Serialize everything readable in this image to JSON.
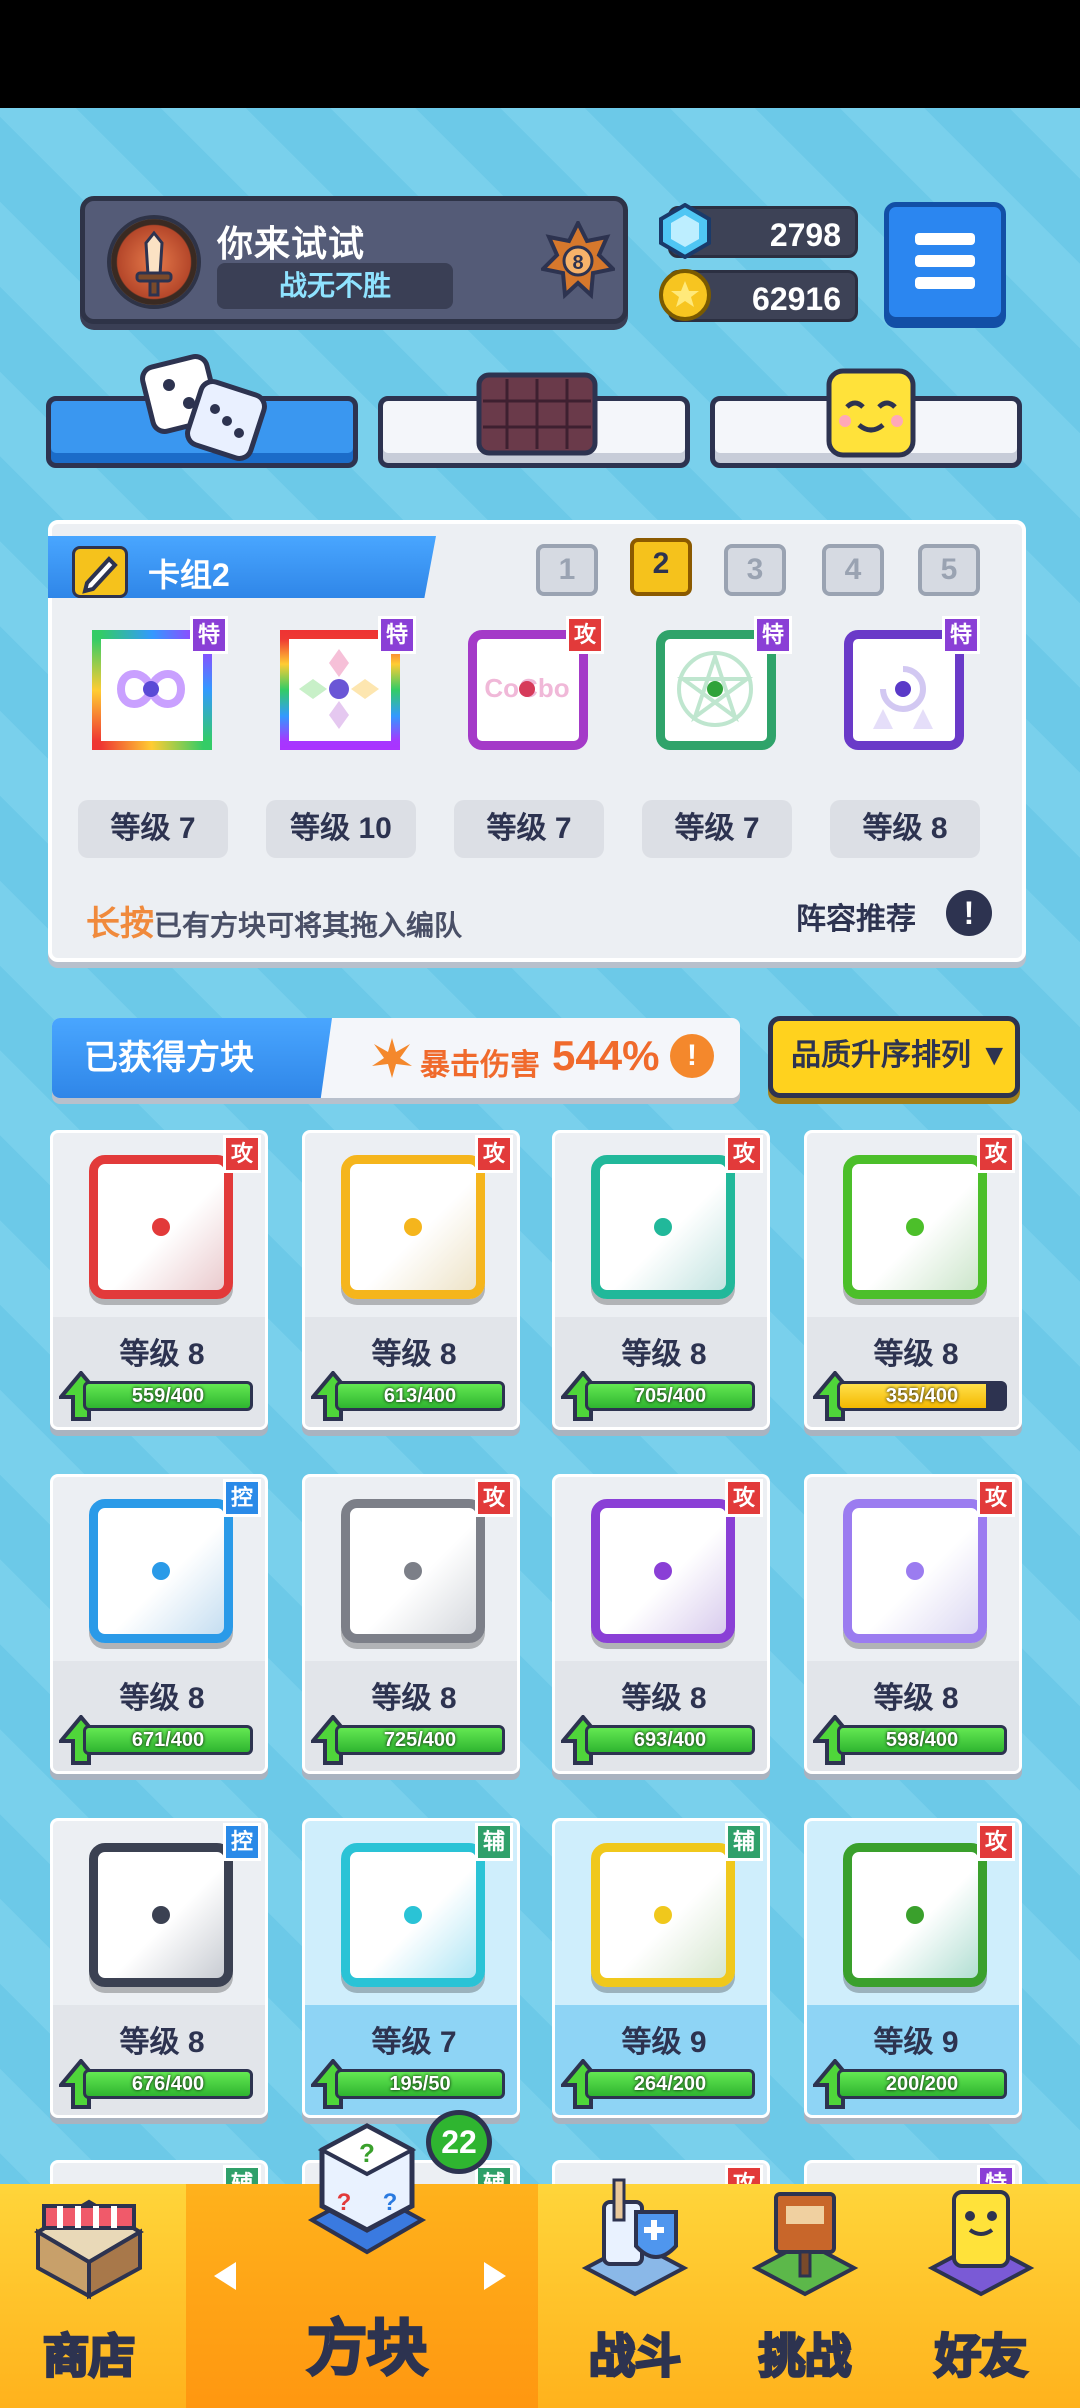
{
  "player": {
    "name": "你来试试",
    "title": "战无不胜",
    "rank": "8"
  },
  "currency": {
    "gems": "2798",
    "gold": "62916"
  },
  "deck": {
    "name": "卡组2",
    "tabs": [
      "1",
      "2",
      "3",
      "4",
      "5"
    ],
    "active_tab": "2",
    "cards": [
      {
        "tag": "特",
        "level": "等级 7",
        "tag_color": "#8a3fd6"
      },
      {
        "tag": "特",
        "level": "等级 10",
        "tag_color": "#8a3fd6"
      },
      {
        "tag": "攻",
        "level": "等级 7",
        "tag_color": "#e23a3a"
      },
      {
        "tag": "特",
        "level": "等级 7",
        "tag_color": "#8a3fd6"
      },
      {
        "tag": "特",
        "level": "等级 8",
        "tag_color": "#8a3fd6"
      }
    ],
    "hint_em": "长按",
    "hint_rest": "已有方块可将其拖入编队",
    "recommend": "阵容推荐",
    "info_icon": "!"
  },
  "owned": {
    "title": "已获得方块",
    "crit_label": "暴击伤害",
    "crit_value": "544%",
    "info_icon": "!",
    "sort_label": "品质升序排列 ▼"
  },
  "cards": [
    {
      "tag": "攻",
      "level": "等级 8",
      "progress": "559/400",
      "fill": 1.0,
      "color": "#e23a3a"
    },
    {
      "tag": "攻",
      "level": "等级 8",
      "progress": "613/400",
      "fill": 1.0,
      "color": "#f5b51c"
    },
    {
      "tag": "攻",
      "level": "等级 8",
      "progress": "705/400",
      "fill": 1.0,
      "color": "#21b89a"
    },
    {
      "tag": "攻",
      "level": "等级 8",
      "progress": "355/400",
      "fill": 0.89,
      "color": "#4cbf2a"
    },
    {
      "tag": "控",
      "level": "等级 8",
      "progress": "671/400",
      "fill": 1.0,
      "color": "#2a9ae8"
    },
    {
      "tag": "攻",
      "level": "等级 8",
      "progress": "725/400",
      "fill": 1.0,
      "color": "#7c7f88"
    },
    {
      "tag": "攻",
      "level": "等级 8",
      "progress": "693/400",
      "fill": 1.0,
      "color": "#8a3fd6"
    },
    {
      "tag": "攻",
      "level": "等级 8",
      "progress": "598/400",
      "fill": 1.0,
      "color": "#9b7cf0"
    },
    {
      "tag": "控",
      "level": "等级 8",
      "progress": "676/400",
      "fill": 1.0,
      "color": "#3b4152"
    },
    {
      "tag": "辅",
      "level": "等级 7",
      "progress": "195/50",
      "fill": 1.0,
      "color": "#2ac3d6"
    },
    {
      "tag": "辅",
      "level": "等级 9",
      "progress": "264/200",
      "fill": 1.0,
      "color": "#f0c81c"
    },
    {
      "tag": "攻",
      "level": "等级 9",
      "progress": "200/200",
      "fill": 1.0,
      "color": "#3aa02c"
    }
  ],
  "partial_tags": [
    "辅",
    "辅",
    "攻",
    "特"
  ],
  "nav": {
    "shop": "商店",
    "blocks": "方块",
    "battle": "战斗",
    "challenge": "挑战",
    "friends": "好友",
    "badge": "22"
  },
  "tag_colors": {
    "攻": "#e23a3a",
    "特": "#8a3fd6",
    "控": "#2a8ae8",
    "辅": "#2fa06a"
  }
}
